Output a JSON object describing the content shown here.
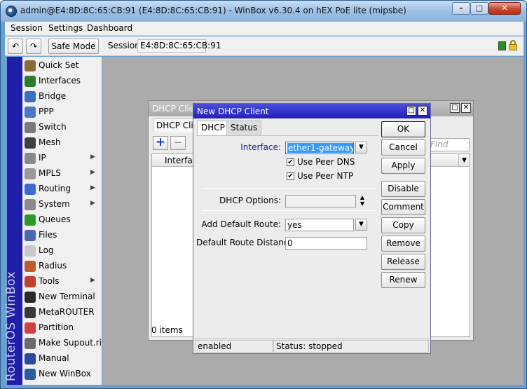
{
  "window": {
    "title": "admin@E4:8D:8C:65:CB:91 (E4:8D:8C:65:CB:91) - WinBox v6.30.4 on hEX PoE lite (mipsbe)",
    "minimize_glyph": "–",
    "maximize_glyph": "□",
    "close_glyph": "✕",
    "icon": "winbox-app-icon"
  },
  "menubar": {
    "items": [
      "Session",
      "Settings",
      "Dashboard"
    ]
  },
  "toolbar": {
    "undo_icon": "↶",
    "redo_icon": "↷",
    "safe_mode_label": "Safe Mode",
    "session_label": "Session:",
    "session_value": "E4:8D:8C:65:CB:91"
  },
  "sidebar": {
    "vertical_text": "RouterOS WinBox",
    "items": [
      {
        "label": "Quick Set",
        "icon": "wand-icon",
        "color": "#8a6a3a",
        "submenu": false
      },
      {
        "label": "Interfaces",
        "icon": "interfaces-icon",
        "color": "#2f7a2f",
        "submenu": false
      },
      {
        "label": "Bridge",
        "icon": "bridge-icon",
        "color": "#3b6fc0",
        "submenu": false
      },
      {
        "label": "PPP",
        "icon": "ppp-icon",
        "color": "#4a78c8",
        "submenu": false
      },
      {
        "label": "Switch",
        "icon": "switch-icon",
        "color": "#7a7a7a",
        "submenu": false
      },
      {
        "label": "Mesh",
        "icon": "mesh-icon",
        "color": "#3f3f3f",
        "submenu": false
      },
      {
        "label": "IP",
        "icon": "ip-icon",
        "color": "#8a8a8a",
        "submenu": true
      },
      {
        "label": "MPLS",
        "icon": "mpls-icon",
        "color": "#9a9a9a",
        "submenu": true
      },
      {
        "label": "Routing",
        "icon": "routing-icon",
        "color": "#3a6ad0",
        "submenu": true
      },
      {
        "label": "System",
        "icon": "gear-icon",
        "color": "#8a8a8a",
        "submenu": true
      },
      {
        "label": "Queues",
        "icon": "queues-icon",
        "color": "#2a9a2a",
        "submenu": false
      },
      {
        "label": "Files",
        "icon": "folder-icon",
        "color": "#4a6ab0",
        "submenu": false
      },
      {
        "label": "Log",
        "icon": "log-icon",
        "color": "#c8c8c8",
        "submenu": false
      },
      {
        "label": "Radius",
        "icon": "radius-icon",
        "color": "#c05a30",
        "submenu": false
      },
      {
        "label": "Tools",
        "icon": "tools-icon",
        "color": "#c04030",
        "submenu": true
      },
      {
        "label": "New Terminal",
        "icon": "terminal-icon",
        "color": "#2a2a2a",
        "submenu": false
      },
      {
        "label": "MetaROUTER",
        "icon": "metarouter-icon",
        "color": "#3a3a3a",
        "submenu": false
      },
      {
        "label": "Partition",
        "icon": "partition-icon",
        "color": "#d04040",
        "submenu": false
      },
      {
        "label": "Make Supout.rif",
        "icon": "supout-icon",
        "color": "#6a6a6a",
        "submenu": false
      },
      {
        "label": "Manual",
        "icon": "help-icon",
        "color": "#2a4aa0",
        "submenu": false
      },
      {
        "label": "New WinBox",
        "icon": "winbox-icon",
        "color": "#2a5aa0",
        "submenu": false
      }
    ]
  },
  "dhcp_list": {
    "title": "DHCP Client",
    "tab_label": "DHCP Clie",
    "add_icon": "+",
    "remove_icon": "−",
    "find_placeholder": "Find",
    "column_interface": "Interface",
    "items_count": "0 items"
  },
  "dialog": {
    "title": "New DHCP Client",
    "tabs": [
      "DHCP",
      "Status"
    ],
    "interface_label": "Interface:",
    "interface_value": "ether1-gateway",
    "use_peer_dns_label": "Use Peer DNS",
    "use_peer_dns_checked": true,
    "use_peer_ntp_label": "Use Peer NTP",
    "use_peer_ntp_checked": true,
    "dhcp_options_label": "DHCP Options:",
    "dhcp_options_value": "",
    "add_default_route_label": "Add Default Route:",
    "add_default_route_value": "yes",
    "default_route_distance_label": "Default Route Distance:",
    "default_route_distance_value": "0",
    "buttons": [
      "OK",
      "Cancel",
      "Apply",
      "Disable",
      "Comment",
      "Copy",
      "Remove",
      "Release",
      "Renew"
    ],
    "status_enabled": "enabled",
    "status_text": "Status: stopped"
  },
  "colors": {
    "sidebar_band": "#1f1fa8",
    "dialog_title": "#2020b8",
    "accent_text": "#1a1aa8",
    "selected_value": "#3399ff"
  }
}
